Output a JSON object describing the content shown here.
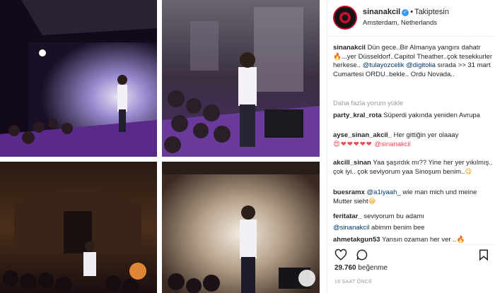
{
  "post": {
    "username": "sinanakcil",
    "follow_status": "Takiptesin",
    "location": "Amsterdam, Netherlands",
    "caption": {
      "author": "sinanakcil",
      "text_1": "Dün gece..Bir Almanya yangını dahatr",
      "text_2": "...yer Düsseldorf..Capitol Theather..çok tesekkurler herkese..",
      "mention_1": "@tulayozcelik",
      "mention_2": "@digitolia",
      "text_3": "sırada >> 31 mart Cumartesi ORDU..bekle.. Ordu Novada.."
    },
    "load_more": "Daha fazla yorum yükle",
    "likes_count": "29.760",
    "likes_label": "beğenme",
    "time_ago": "16 SAAT ÖNCE"
  },
  "comments": [
    {
      "user": "party_kral_rota",
      "text": "Süperdi yakında yeniden Avrupa"
    },
    {
      "user": "ayse_sinan_akcil_",
      "text": "Her gittiğin yer olaaay",
      "mention": "@sinanakcil"
    },
    {
      "user": "akcill_sinan",
      "text": "Yaa şaşırdık mı?? Yine her yer yıkılmış.. çok iyi.. çok seviyorum yaa Sinoşum benim.."
    },
    {
      "user": "buesramx",
      "mention": "@a1iyaah_",
      "text": "wie man mich und meine Mutter sieht"
    },
    {
      "user": "feritatar_",
      "text": "seviyorum bu adamı"
    },
    {
      "mention": "@sinanakcil",
      "text": "abimm benim bee"
    },
    {
      "user": "ahmetakgun53",
      "text": "Yansın ozaman her ver .."
    }
  ],
  "icons": {
    "like": "heart-icon",
    "comment": "speech-bubble-icon",
    "save": "bookmark-icon",
    "verified": "verified-badge-icon"
  },
  "colors": {
    "mention": "#003569",
    "muted": "#999999",
    "verified": "#3897f0",
    "heart": "#ed4956"
  }
}
